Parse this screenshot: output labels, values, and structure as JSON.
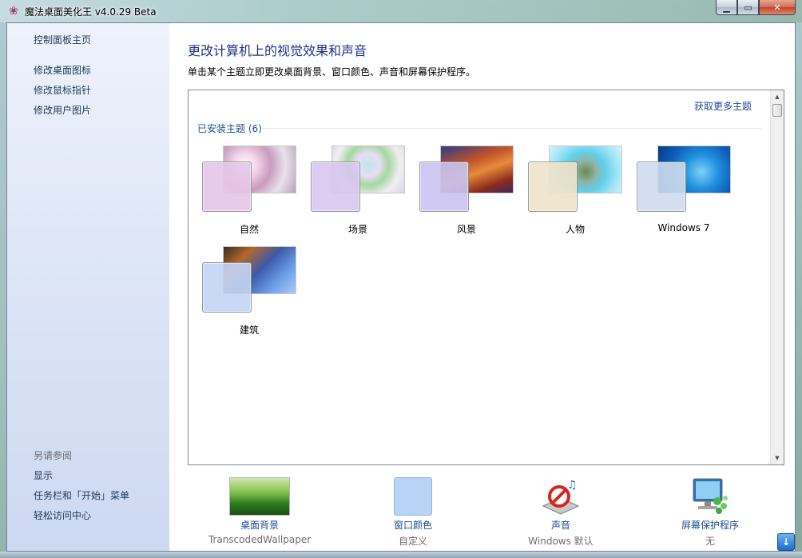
{
  "window": {
    "title": "魔法桌面美化王 v4.0.29 Beta",
    "app_icon": "lotus-icon",
    "minimize_icon": "minimize-icon",
    "maximize_icon": "maximize-icon",
    "close_icon": "close-icon"
  },
  "sidebar": {
    "home": "控制面板主页",
    "links": [
      "修改桌面图标",
      "修改鼠标指针",
      "修改用户图片"
    ],
    "see_also_title": "另请参阅",
    "see_also": [
      "显示",
      "任务栏和「开始」菜单",
      "轻松访问中心"
    ]
  },
  "main": {
    "heading": "更改计算机上的视觉效果和声音",
    "subtext": "单击某个主题立即更改桌面背景、窗口颜色、声音和屏幕保护程序。",
    "more_themes": "获取更多主题",
    "installed_label": "已安装主题 (6)",
    "themes": [
      {
        "name": "自然",
        "color": "#e6c6e8"
      },
      {
        "name": "场景",
        "color": "#d9c7f0"
      },
      {
        "name": "风景",
        "color": "#c9c3f2"
      },
      {
        "name": "人物",
        "color": "#efe3c9"
      },
      {
        "name": "Windows 7",
        "color": "#cfdcef"
      },
      {
        "name": "建筑",
        "color": "#c4d4f3"
      }
    ]
  },
  "bottom": {
    "wallpaper": {
      "label": "桌面背景",
      "value": "TranscodedWallpaper",
      "icon": "wallpaper-icon"
    },
    "color": {
      "label": "窗口颜色",
      "value": "自定义",
      "swatch": "#b8d3f5"
    },
    "sound": {
      "label": "声音",
      "value": "Windows 默认",
      "icon": "sound-icon"
    },
    "screensaver": {
      "label": "屏幕保护程序",
      "value": "无",
      "icon": "screensaver-icon"
    }
  },
  "colors": {
    "link": "#1e4d97",
    "heading": "#1e3287"
  }
}
